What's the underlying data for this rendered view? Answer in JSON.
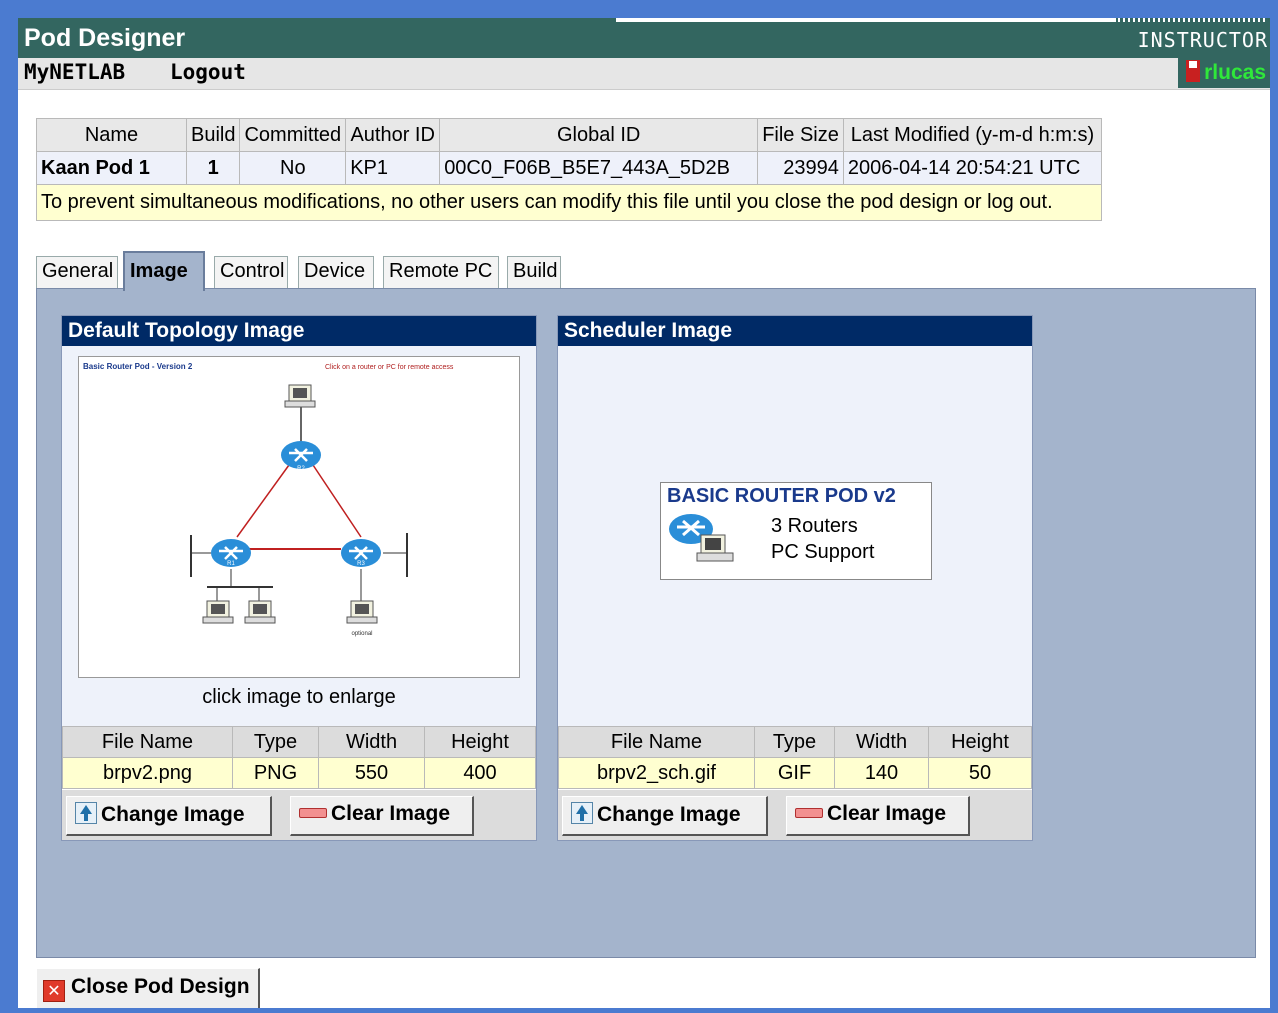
{
  "header": {
    "app_title": "Pod Designer",
    "role": "INSTRUCTOR",
    "menu": [
      "MyNETLAB",
      "Logout"
    ],
    "user": "rlucas"
  },
  "file_info": {
    "columns": [
      "Name",
      "Build",
      "Committed",
      "Author ID",
      "Global ID",
      "File Size",
      "Last Modified (y-m-d h:m:s)"
    ],
    "row": {
      "name": "Kaan Pod 1",
      "build": "1",
      "committed": "No",
      "author_id": "KP1",
      "global_id": "00C0_F06B_B5E7_443A_5D2B",
      "file_size": "23994",
      "last_modified": "2006-04-14 20:54:21 UTC"
    },
    "notice": "To prevent simultaneous modifications, no other users can modify this file until you close the pod design or log out."
  },
  "tabs": [
    "General",
    "Image",
    "Control",
    "Device",
    "Remote PC",
    "Build"
  ],
  "active_tab": "Image",
  "default_image": {
    "title": "Default Topology Image",
    "thumb_title": "Basic Router Pod - Version 2",
    "thumb_note": "Click on a router or PC for remote access",
    "thumb_labels": {
      "r1": "R1",
      "r2": "R2",
      "r3": "R3",
      "footer": "optional"
    },
    "caption": "click image to enlarge",
    "columns": [
      "File Name",
      "Type",
      "Width",
      "Height"
    ],
    "file_name": "brpv2.png",
    "type": "PNG",
    "width": "550",
    "height": "400",
    "change_label": "Change Image",
    "clear_label": "Clear Image"
  },
  "scheduler_image": {
    "title": "Scheduler Image",
    "box_title": "BASIC ROUTER POD v2",
    "line1": "3 Routers",
    "line2": "PC Support",
    "columns": [
      "File Name",
      "Type",
      "Width",
      "Height"
    ],
    "file_name": "brpv2_sch.gif",
    "type": "GIF",
    "width": "140",
    "height": "50",
    "change_label": "Change Image",
    "clear_label": "Clear Image"
  },
  "close_label": "Close Pod Design",
  "colors": {
    "header_bg": "#336660",
    "panel_header": "#002a66",
    "tab_panel_bg": "#a4b4cc",
    "notice_bg": "#ffffd0",
    "user_color": "#2fe83a"
  }
}
